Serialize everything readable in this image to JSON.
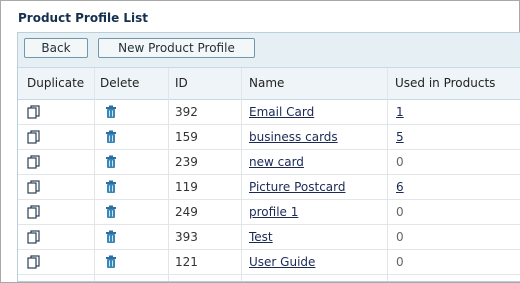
{
  "page": {
    "title": "Product Profile List"
  },
  "toolbar": {
    "back_label": "Back",
    "new_label": "New Product Profile"
  },
  "table": {
    "columns": [
      "Duplicate",
      "Delete",
      "ID",
      "Name",
      "Used in Products"
    ],
    "rows": [
      {
        "id": "392",
        "name": "Email Card",
        "used": "1"
      },
      {
        "id": "159",
        "name": "business cards",
        "used": "5"
      },
      {
        "id": "239",
        "name": "new card",
        "used": "0"
      },
      {
        "id": "119",
        "name": "Picture Postcard",
        "used": "6"
      },
      {
        "id": "249",
        "name": "profile 1",
        "used": "0"
      },
      {
        "id": "393",
        "name": "Test",
        "used": "0"
      },
      {
        "id": "121",
        "name": "User Guide",
        "used": "0"
      }
    ]
  },
  "icons": {
    "duplicate": "duplicate-icon",
    "delete": "trash-icon"
  },
  "colors": {
    "title": "#15314e",
    "toolbar_bg": "#e6f0f4",
    "delete_icon": "#2a6f9e"
  }
}
